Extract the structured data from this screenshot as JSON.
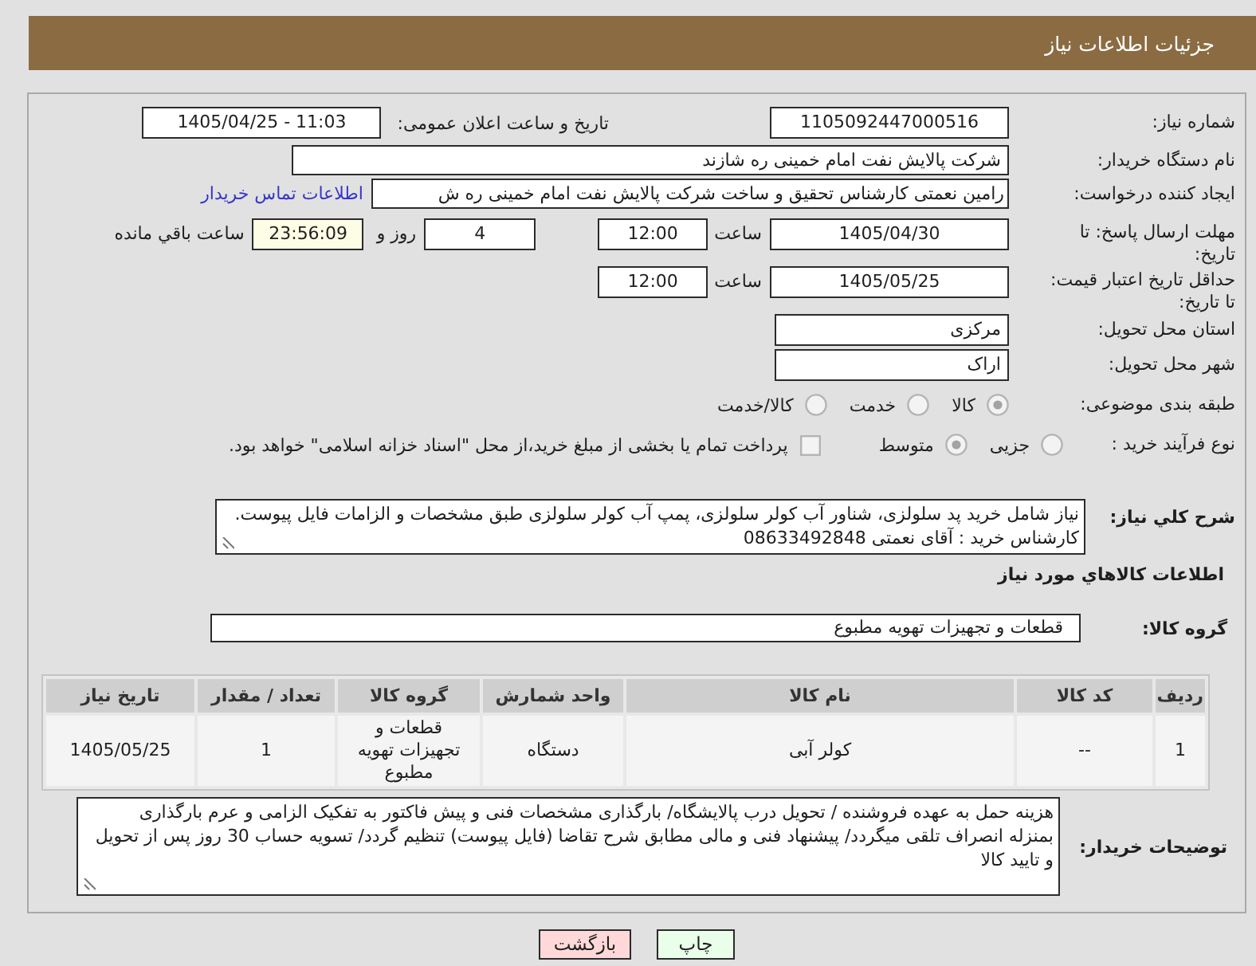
{
  "header": {
    "title": "جزئیات اطلاعات نیاز"
  },
  "need": {
    "number_label": "شماره نیاز:",
    "number": "1105092447000516",
    "announce_label": "تاریخ و ساعت اعلان عمومی:",
    "announce": "1405/04/25 - 11:03"
  },
  "buyer": {
    "label": "نام دستگاه خریدار:",
    "value": "شرکت پالایش نفت امام خمینی  ره  شازند"
  },
  "requester": {
    "label": "ایجاد کننده درخواست:",
    "value": "رامین نعمتی کارشناس تحقیق و ساخت  شرکت پالایش نفت امام خمینی  ره  ش",
    "contact_link": "اطلاعات تماس خریدار"
  },
  "reply_deadline": {
    "label": "مهلت ارسال پاسخ: تا تاریخ:",
    "date": "1405/04/30",
    "time_label": "ساعت",
    "time": "12:00",
    "days": "4",
    "days_label": "روز و",
    "remaining": "23:56:09",
    "remaining_label": "ساعت باقي مانده"
  },
  "price_validity": {
    "label": "حداقل تاریخ اعتبار قیمت: تا تاریخ:",
    "date": "1405/05/25",
    "time_label": "ساعت",
    "time": "12:00"
  },
  "delivery_province": {
    "label": "استان محل تحویل:",
    "value": "مرکزی"
  },
  "delivery_city": {
    "label": "شهر محل تحویل:",
    "value": "اراک"
  },
  "category": {
    "label": "طبقه بندی موضوعی:",
    "options": [
      {
        "label": "کالا",
        "selected": true
      },
      {
        "label": "خدمت",
        "selected": false
      },
      {
        "label": "کالا/خدمت",
        "selected": false
      }
    ]
  },
  "purchase_process": {
    "label": "نوع فرآیند خرید :",
    "options": [
      {
        "label": "جزیی",
        "selected": false
      },
      {
        "label": "متوسط",
        "selected": true
      }
    ],
    "treasury_payment": {
      "label": "پرداخت تمام یا بخشی از مبلغ خرید،از محل \"اسناد خزانه اسلامی\" خواهد بود.",
      "checked": false
    }
  },
  "description": {
    "label": "شرح کلي نیاز:",
    "value": "نیاز شامل خرید پد سلولزی، شناور آب کولر سلولزی، پمپ آب کولر سلولزی طبق مشخصات و الزامات فایل پیوست. کارشناس خرید : آقای نعمتی 08633492848"
  },
  "goods": {
    "heading": "اطلاعات کالاهاي مورد نیاز",
    "group_label": "گروه کالا:",
    "group": "قطعات و تجهیزات تهویه مطبوع"
  },
  "table": {
    "columns": [
      "ردیف",
      "کد کالا",
      "نام کالا",
      "واحد شمارش",
      "گروه کالا",
      "تعداد / مقدار",
      "تاریخ نیاز"
    ],
    "rows": [
      [
        "1",
        "--",
        "کولر آبی",
        "دستگاه",
        "قطعات و تجهیزات تهویه مطبوع",
        "1",
        "1405/05/25"
      ]
    ]
  },
  "buyer_notes": {
    "label": "توضیحات خریدار:",
    "value": "هزینه حمل به عهده فروشنده / تحویل درب پالایشگاه/ بارگذاری مشخصات فنی و پیش فاکتور به تفکیک الزامی و عرم بارگذاری بمنزله انصراف تلقی میگردد/ پیشنهاد فنی و مالی مطابق شرح تقاضا (فایل پیوست) تنظیم گردد/ تسویه حساب 30 روز پس از تحویل و تایید کالا"
  },
  "buttons": [
    {
      "label": "چاپ",
      "kind": "print"
    },
    {
      "label": "بازگشت",
      "kind": "back"
    }
  ]
}
